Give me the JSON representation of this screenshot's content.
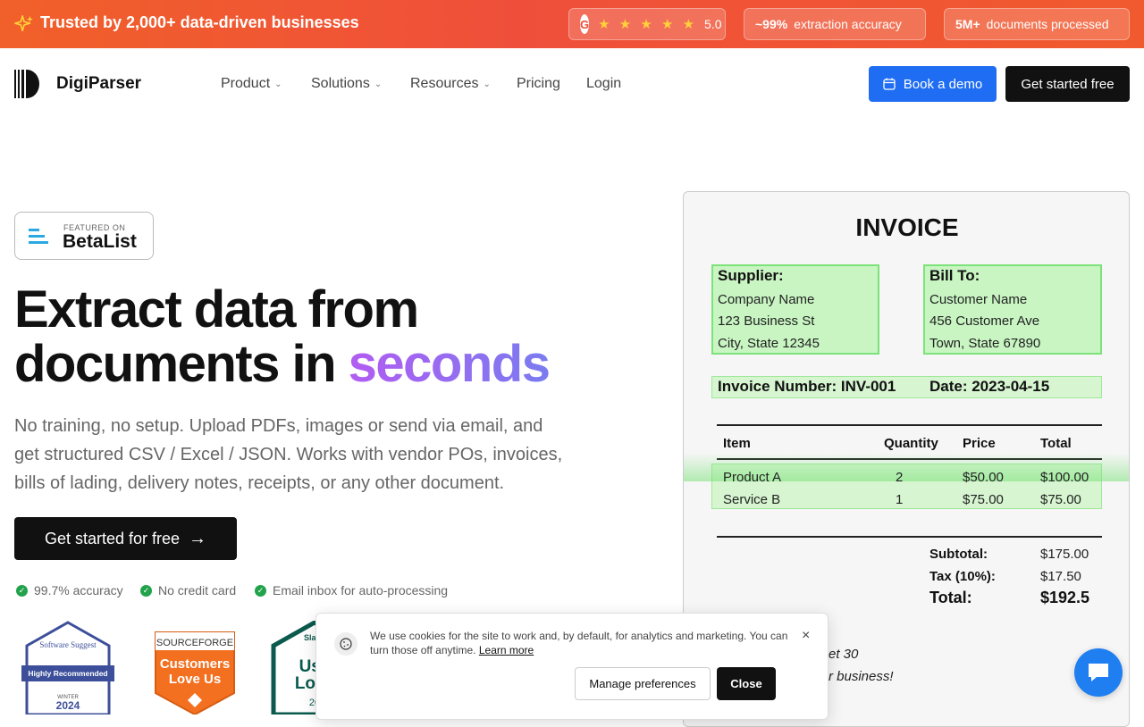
{
  "banner": {
    "trust_text": "Trusted by 2,000+ data-driven businesses",
    "rating_badge": "G",
    "stars": "★ ★ ★ ★ ★",
    "rating": "5.0",
    "accuracy_value": "~99%",
    "accuracy_label": "extraction accuracy",
    "docs_value": "5M+",
    "docs_label": "documents processed"
  },
  "nav": {
    "brand": "DigiParser",
    "items": [
      {
        "label": "Product",
        "has_dropdown": true
      },
      {
        "label": "Solutions",
        "has_dropdown": true
      },
      {
        "label": "Resources",
        "has_dropdown": true
      },
      {
        "label": "Pricing",
        "has_dropdown": false
      },
      {
        "label": "Login",
        "has_dropdown": false
      }
    ],
    "demo_label": "Book a demo",
    "start_label": "Get started free"
  },
  "hero": {
    "featured_on": "FEATURED ON",
    "featured_name": "BetaList",
    "headline_line1": "Extract data from",
    "headline_line2_a": "documents in ",
    "headline_line2_b": "seconds",
    "subtitle": "No training, no setup. Upload PDFs, images or send via email, and get structured CSV / Excel / JSON. Works with vendor POs, invoices, bills of lading, delivery notes, receipts, or any other document.",
    "cta_label": "Get started for free",
    "checks": [
      "99.7% accuracy",
      "No credit card",
      "Email inbox for auto-processing"
    ]
  },
  "badges": {
    "ss_name": "Software Suggest",
    "ss_label": "Highly Recommended",
    "ss_season": "WINTER",
    "ss_year": "2024",
    "sf_brand": "SOURCEFORGE",
    "sf_line1": "Customers",
    "sf_line2": "Love Us",
    "sl_brand": "Slash",
    "sl_line1": "Use",
    "sl_line2": "Love",
    "sl_year": "20"
  },
  "invoice": {
    "title": "INVOICE",
    "supplier_label": "Supplier:",
    "supplier_lines": [
      "Company Name",
      "123 Business St",
      "City, State 12345"
    ],
    "billto_label": "Bill To:",
    "billto_lines": [
      "Customer Name",
      "456 Customer Ave",
      "Town, State 67890"
    ],
    "invoice_number": "Invoice Number: INV-001",
    "date": "Date: 2023-04-15",
    "columns": [
      "Item",
      "Quantity",
      "Price",
      "Total"
    ],
    "rows": [
      {
        "item": "Product A",
        "qty": "2",
        "price": "$50.00",
        "total": "$100.00"
      },
      {
        "item": "Service B",
        "qty": "1",
        "price": "$75.00",
        "total": "$75.00"
      }
    ],
    "subtotal_label": "Subtotal:",
    "subtotal": "$175.00",
    "tax_label": "Tax (10%):",
    "tax": "$17.50",
    "total_label": "Total:",
    "total": "$192.5",
    "footer_1": "et 30",
    "footer_2": "r business!"
  },
  "cookie": {
    "message": "We use cookies for the site to work and, by default, for analytics and marketing. You can turn those off anytime. ",
    "learn_more": "Learn more",
    "manage_label": "Manage preferences",
    "close_label": "Close",
    "close_icon": "×"
  },
  "colors": {
    "banner": "#ef5134",
    "demo_button": "#1f6df3",
    "highlight": "#c8f5c2",
    "check": "#22a34b",
    "headline_gradient_start": "#b25cf2",
    "headline_gradient_end": "#7a7cf0"
  }
}
